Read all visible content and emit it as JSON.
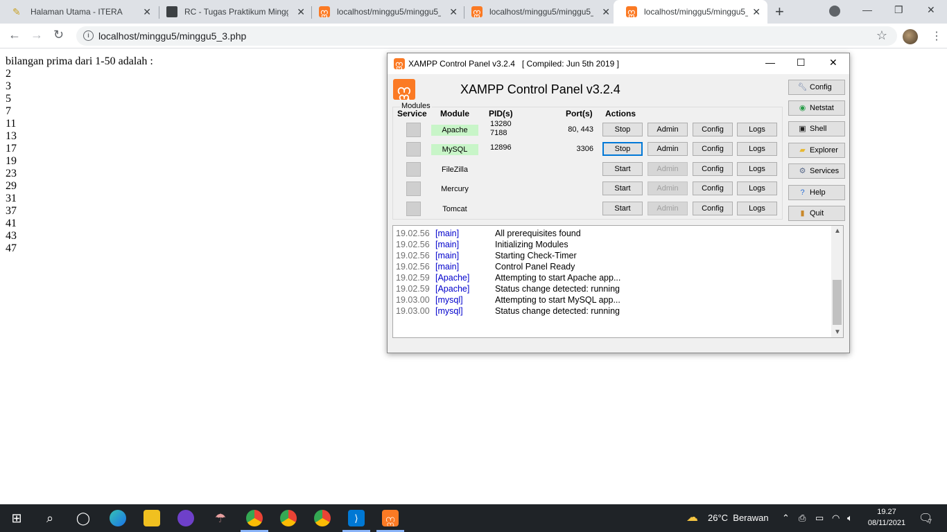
{
  "browser": {
    "tabs": [
      {
        "title": "Halaman Utama - ITERA",
        "icon": "itera-icon"
      },
      {
        "title": "RC - Tugas Praktikum Minggu",
        "icon": "document-icon"
      },
      {
        "title": "localhost/minggu5/minggu5_",
        "icon": "xampp-icon"
      },
      {
        "title": "localhost/minggu5/minggu5_",
        "icon": "xampp-icon"
      },
      {
        "title": "localhost/minggu5/minggu5_",
        "icon": "xampp-icon"
      }
    ],
    "active_tab": 4,
    "url": "localhost/minggu5/minggu5_3.php"
  },
  "page": {
    "heading": "bilangan prima dari 1-50 adalah :",
    "primes": [
      "2",
      "3",
      "5",
      "7",
      "11",
      "13",
      "17",
      "19",
      "23",
      "29",
      "31",
      "37",
      "41",
      "43",
      "47"
    ]
  },
  "xampp": {
    "window_title": "XAMPP Control Panel v3.2.4   [ Compiled: Jun 5th 2019 ]",
    "heading": "XAMPP Control Panel v3.2.4",
    "modules_legend": "Modules",
    "columns": {
      "service": "Service",
      "module": "Module",
      "pid": "PID(s)",
      "port": "Port(s)",
      "actions": "Actions"
    },
    "modules": [
      {
        "name": "Apache",
        "pid": "13280\n7188",
        "port": "80, 443",
        "action": "Stop",
        "admin": "Admin",
        "config": "Config",
        "logs": "Logs",
        "running": true
      },
      {
        "name": "MySQL",
        "pid": "12896",
        "port": "3306",
        "action": "Stop",
        "admin": "Admin",
        "config": "Config",
        "logs": "Logs",
        "running": true
      },
      {
        "name": "FileZilla",
        "pid": "",
        "port": "",
        "action": "Start",
        "admin": "Admin",
        "config": "Config",
        "logs": "Logs",
        "running": false
      },
      {
        "name": "Mercury",
        "pid": "",
        "port": "",
        "action": "Start",
        "admin": "Admin",
        "config": "Config",
        "logs": "Logs",
        "running": false
      },
      {
        "name": "Tomcat",
        "pid": "",
        "port": "",
        "action": "Start",
        "admin": "Admin",
        "config": "Config",
        "logs": "Logs",
        "running": false
      }
    ],
    "side_buttons": [
      {
        "label": "Config",
        "icon": "wrench-icon"
      },
      {
        "label": "Netstat",
        "icon": "globe-icon"
      },
      {
        "label": "Shell",
        "icon": "terminal-icon"
      },
      {
        "label": "Explorer",
        "icon": "folder-icon"
      },
      {
        "label": "Services",
        "icon": "services-icon"
      },
      {
        "label": "Help",
        "icon": "help-icon"
      },
      {
        "label": "Quit",
        "icon": "quit-icon"
      }
    ],
    "log": [
      {
        "time": "19.02.56",
        "module": "[main]",
        "message": "All prerequisites found"
      },
      {
        "time": "19.02.56",
        "module": "[main]",
        "message": "Initializing Modules"
      },
      {
        "time": "19.02.56",
        "module": "[main]",
        "message": "Starting Check-Timer"
      },
      {
        "time": "19.02.56",
        "module": "[main]",
        "message": "Control Panel Ready"
      },
      {
        "time": "19.02.59",
        "module": "[Apache]",
        "message": "Attempting to start Apache app..."
      },
      {
        "time": "19.02.59",
        "module": "[Apache]",
        "message": "Status change detected: running"
      },
      {
        "time": "19.03.00",
        "module": "[mysql]",
        "message": "Attempting to start MySQL app..."
      },
      {
        "time": "19.03.00",
        "module": "[mysql]",
        "message": "Status change detected: running"
      }
    ]
  },
  "taskbar": {
    "weather": "26°C  Berawan",
    "time": "19.27",
    "date": "08/11/2021",
    "notification_count": "7"
  },
  "colors": {
    "xampp_orange": "#fb7a24",
    "running_green": "#c8f5c8",
    "log_module_blue": "#0000cc"
  }
}
